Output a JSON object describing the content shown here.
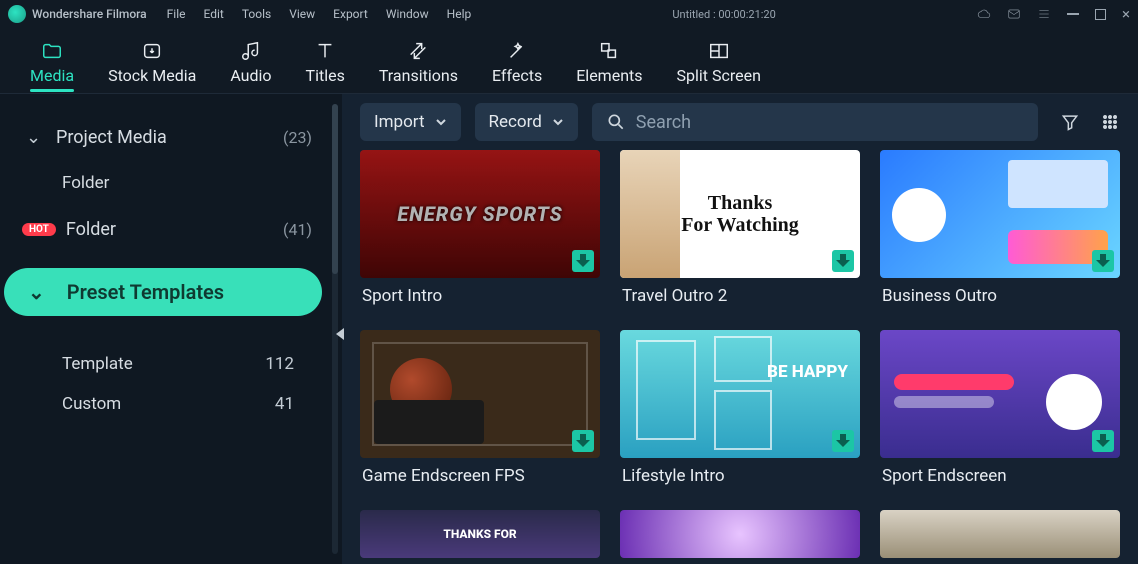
{
  "titlebar": {
    "brand": "Wondershare Filmora",
    "menus": [
      "File",
      "Edit",
      "Tools",
      "View",
      "Export",
      "Window",
      "Help"
    ],
    "project": "Untitled : 00:00:21:20"
  },
  "tabs": [
    {
      "id": "media",
      "label": "Media"
    },
    {
      "id": "stock",
      "label": "Stock Media"
    },
    {
      "id": "audio",
      "label": "Audio"
    },
    {
      "id": "titles",
      "label": "Titles"
    },
    {
      "id": "transitions",
      "label": "Transitions"
    },
    {
      "id": "effects",
      "label": "Effects"
    },
    {
      "id": "elements",
      "label": "Elements"
    },
    {
      "id": "split",
      "label": "Split Screen"
    }
  ],
  "active_tab": "media",
  "sidebar": {
    "project_media": {
      "label": "Project Media",
      "count": "(23)"
    },
    "folder1": {
      "label": "Folder"
    },
    "folder2": {
      "label": "Folder",
      "count": "(41)",
      "badge": "HOT"
    },
    "preset": {
      "label": "Preset Templates"
    },
    "template": {
      "label": "Template",
      "count": "112"
    },
    "custom": {
      "label": "Custom",
      "count": "41"
    }
  },
  "toolbar": {
    "import": "Import",
    "record": "Record",
    "search_placeholder": "Search"
  },
  "cards": {
    "r1": [
      {
        "title": "Sport Intro",
        "overlay": "ENERGY SPORTS",
        "cls": "t-sport"
      },
      {
        "title": "Travel Outro 2",
        "overlay": "Thanks\nFor Watching",
        "cls": "t-travel"
      },
      {
        "title": "Business Outro",
        "overlay": "",
        "cls": "t-biz"
      }
    ],
    "r2": [
      {
        "title": "Game Endscreen FPS",
        "overlay": "",
        "cls": "t-game"
      },
      {
        "title": "Lifestyle Intro",
        "overlay": "BE HAPPY",
        "cls": "t-life"
      },
      {
        "title": "Sport Endscreen",
        "overlay": "",
        "cls": "t-spend"
      }
    ],
    "r3_overlay": "THANKS FOR"
  }
}
